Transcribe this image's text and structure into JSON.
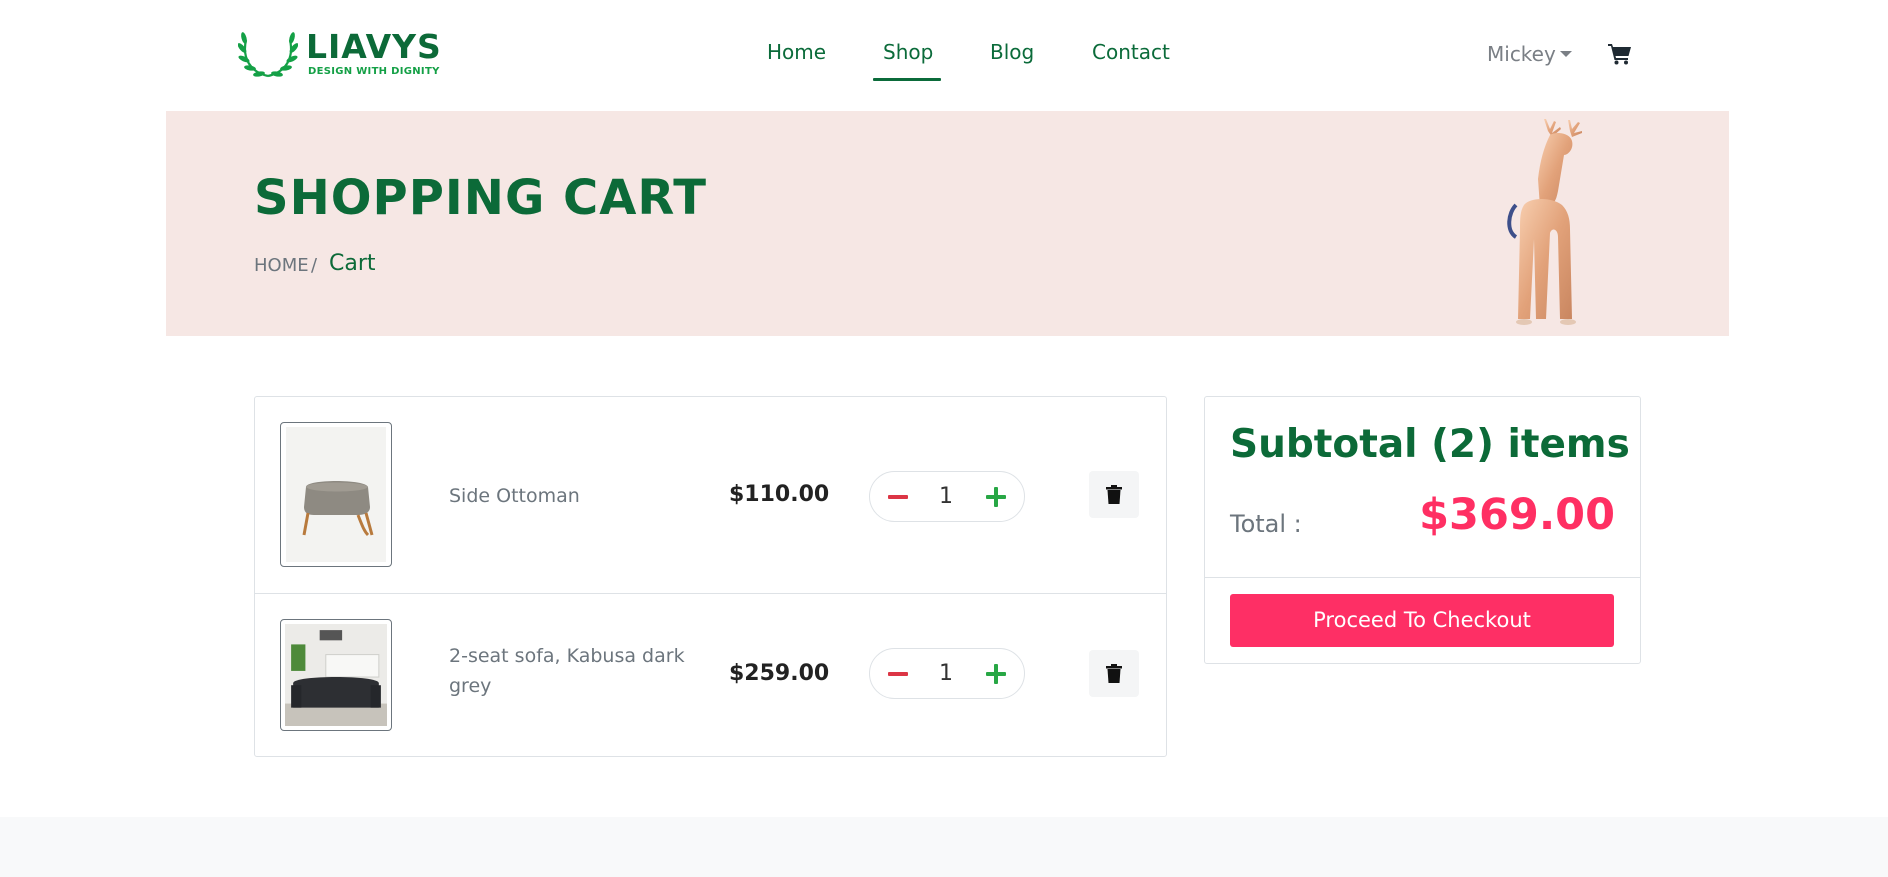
{
  "brand": {
    "name": "LIAVYS",
    "tagline": "DESIGN WITH DIGNITY",
    "logo_icon": "laurel-wreath-icon",
    "primary_color": "#0c6a38",
    "accent_color": "#fe2f65"
  },
  "nav": {
    "links": [
      {
        "label": "Home"
      },
      {
        "label": "Shop",
        "active": true
      },
      {
        "label": "Blog"
      },
      {
        "label": "Contact"
      }
    ],
    "user": "Mickey",
    "cart_icon": "cart-icon"
  },
  "banner": {
    "title": "SHOPPING CART",
    "breadcrumb": {
      "home": "HOME",
      "separator": "/",
      "current": "Cart"
    },
    "background_color": "#f6e7e4"
  },
  "cart": {
    "items": [
      {
        "name": "Side Ottoman",
        "price": "$110.00",
        "quantity": "1",
        "image": "ottoman-image"
      },
      {
        "name": "2-seat sofa, Kabusa dark grey",
        "price": "$259.00",
        "quantity": "1",
        "image": "sofa-image"
      }
    ],
    "remove_icon": "trash-icon"
  },
  "summary": {
    "title": "Subtotal (2) items",
    "total_label": "Total :",
    "total_value": "$369.00",
    "checkout_label": "Proceed To Checkout"
  }
}
